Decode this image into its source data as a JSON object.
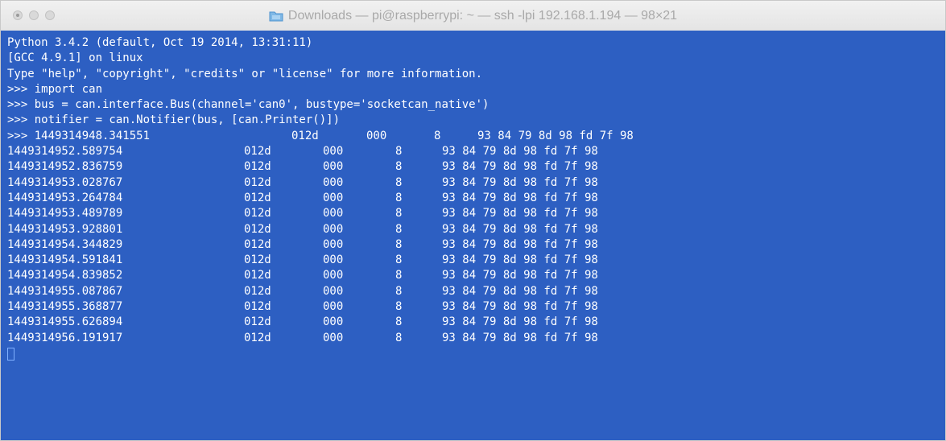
{
  "window": {
    "title": "Downloads — pi@raspberrypi: ~ — ssh -lpi 192.168.1.194 — 98×21"
  },
  "terminal": {
    "header_lines": [
      "Python 3.4.2 (default, Oct 19 2014, 13:31:11)",
      "[GCC 4.9.1] on linux",
      "Type \"help\", \"copyright\", \"credits\" or \"license\" for more information.",
      ">>> import can",
      ">>> bus = can.interface.Bus(channel='can0', bustype='socketcan_native')",
      ">>> notifier = can.Notifier(bus, [can.Printer()])"
    ],
    "first_row": {
      "timestamp": ">>> 1449314948.341551",
      "id": "012d",
      "flags": "000",
      "dlc": "8",
      "data": "93 84 79 8d 98 fd 7f 98"
    },
    "rows": [
      {
        "timestamp": "1449314952.589754",
        "id": "012d",
        "flags": "000",
        "dlc": "8",
        "data": "93 84 79 8d 98 fd 7f 98"
      },
      {
        "timestamp": "1449314952.836759",
        "id": "012d",
        "flags": "000",
        "dlc": "8",
        "data": "93 84 79 8d 98 fd 7f 98"
      },
      {
        "timestamp": "1449314953.028767",
        "id": "012d",
        "flags": "000",
        "dlc": "8",
        "data": "93 84 79 8d 98 fd 7f 98"
      },
      {
        "timestamp": "1449314953.264784",
        "id": "012d",
        "flags": "000",
        "dlc": "8",
        "data": "93 84 79 8d 98 fd 7f 98"
      },
      {
        "timestamp": "1449314953.489789",
        "id": "012d",
        "flags": "000",
        "dlc": "8",
        "data": "93 84 79 8d 98 fd 7f 98"
      },
      {
        "timestamp": "1449314953.928801",
        "id": "012d",
        "flags": "000",
        "dlc": "8",
        "data": "93 84 79 8d 98 fd 7f 98"
      },
      {
        "timestamp": "1449314954.344829",
        "id": "012d",
        "flags": "000",
        "dlc": "8",
        "data": "93 84 79 8d 98 fd 7f 98"
      },
      {
        "timestamp": "1449314954.591841",
        "id": "012d",
        "flags": "000",
        "dlc": "8",
        "data": "93 84 79 8d 98 fd 7f 98"
      },
      {
        "timestamp": "1449314954.839852",
        "id": "012d",
        "flags": "000",
        "dlc": "8",
        "data": "93 84 79 8d 98 fd 7f 98"
      },
      {
        "timestamp": "1449314955.087867",
        "id": "012d",
        "flags": "000",
        "dlc": "8",
        "data": "93 84 79 8d 98 fd 7f 98"
      },
      {
        "timestamp": "1449314955.368877",
        "id": "012d",
        "flags": "000",
        "dlc": "8",
        "data": "93 84 79 8d 98 fd 7f 98"
      },
      {
        "timestamp": "1449314955.626894",
        "id": "012d",
        "flags": "000",
        "dlc": "8",
        "data": "93 84 79 8d 98 fd 7f 98"
      },
      {
        "timestamp": "1449314956.191917",
        "id": "012d",
        "flags": "000",
        "dlc": "8",
        "data": "93 84 79 8d 98 fd 7f 98"
      }
    ]
  },
  "colors": {
    "terminal_background": "#2d5fc2",
    "terminal_text": "#ffffff",
    "titlebar_text": "#a9a9a9"
  }
}
